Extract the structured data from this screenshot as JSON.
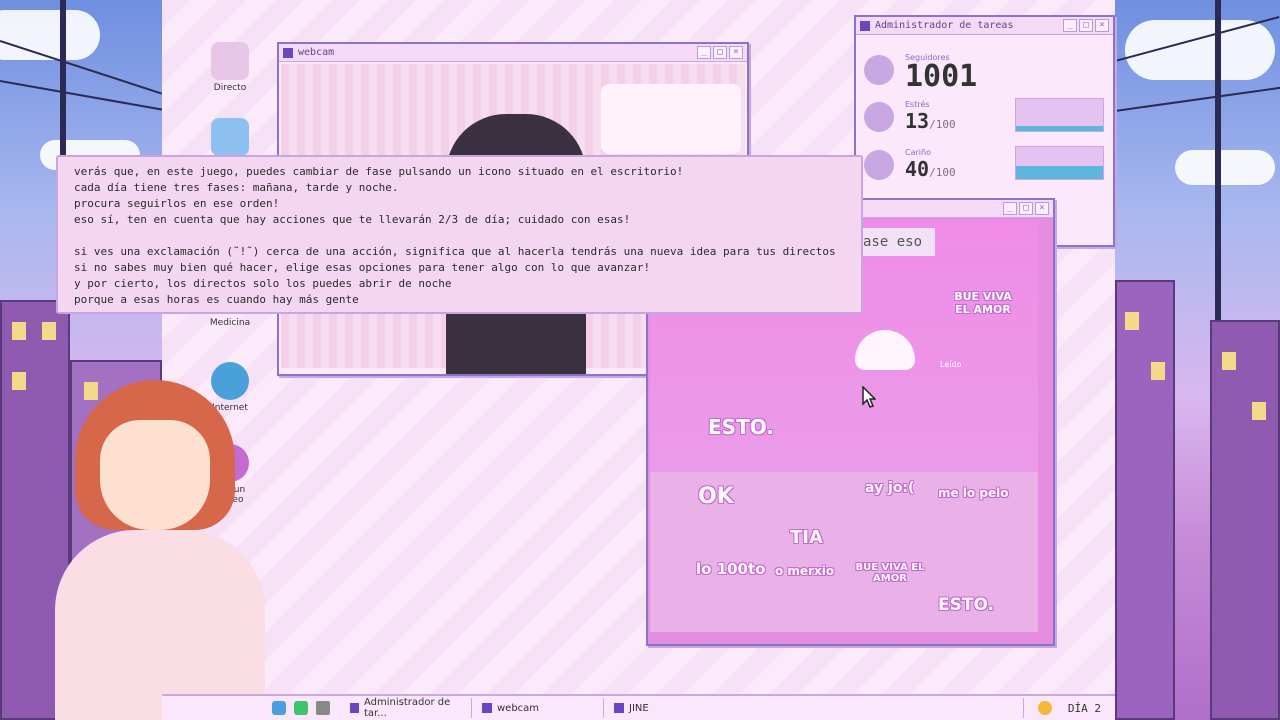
{
  "desktop_icons": [
    {
      "label": "Directo"
    },
    {
      "label": "Medicina"
    },
    {
      "label": "Internet"
    },
    {
      "label": "Dar un paseo"
    }
  ],
  "webcam_window": {
    "title": "webcam"
  },
  "task_manager": {
    "title": "Administrador de tareas",
    "followers": {
      "label": "Seguidores",
      "value": "1001"
    },
    "stress": {
      "label": "Estrés",
      "value": "13",
      "max": "/100",
      "fill": 0.13
    },
    "affection": {
      "label": "Cariño",
      "value": "40",
      "max": "/100",
      "fill": 0.4
    }
  },
  "chat_window": {
    "partial_text": "ase eso",
    "stickers": {
      "top": "BUE VIVA EL AMOR",
      "read": "Leído",
      "esto": "ESTO."
    },
    "palette": [
      "OK",
      "TIA",
      "ay jo:(",
      "me lo pelo",
      "lo 100to",
      "o merxio",
      "BUE VIVA EL AMOR",
      "ESTO."
    ]
  },
  "dialog": {
    "text": "verás que, en este juego, puedes cambiar de fase pulsando un icono situado en el escritorio!\ncada día tiene tres fases: mañana, tarde y noche.\nprocura seguirlos en ese orden!\neso sí, ten en cuenta que hay acciones que te llevarán 2/3 de día; cuidado con esas!\n\nsi ves una exclamación (˜!˜) cerca de una acción, significa que al hacerla tendrás una nueva idea para tus directos\nsi no sabes muy bien qué hacer, elige esas opciones para tener algo con lo que avanzar!\ny por cierto, los directos solo los puedes abrir de noche\nporque a esas horas es cuando hay más gente"
  },
  "taskbar": {
    "items": [
      "Administrador de tar...",
      "webcam",
      "JINE"
    ],
    "day": "DÍA 2"
  },
  "colors": {
    "accent": "#6b46c1",
    "bar_blue": "#5fb6dc",
    "bar_pink": "#e4c3f0"
  }
}
